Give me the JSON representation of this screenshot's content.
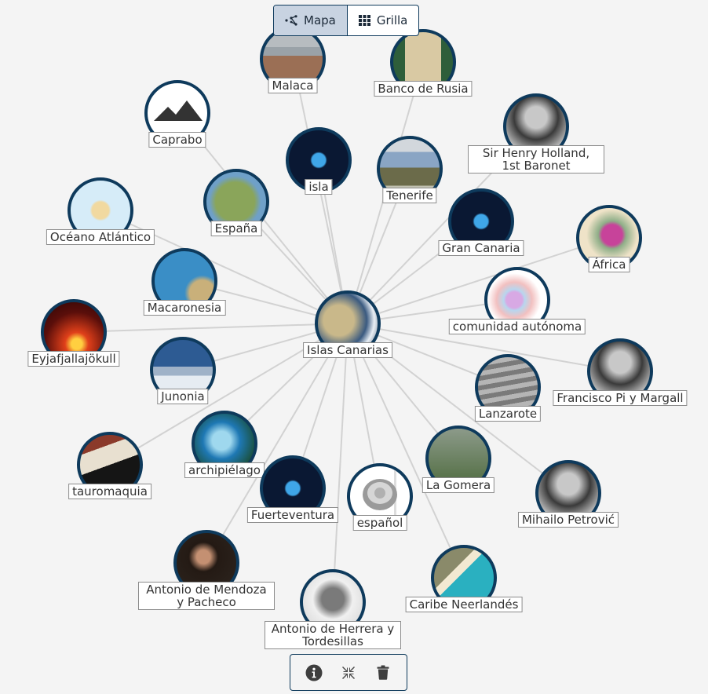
{
  "view_toggle": {
    "options": [
      {
        "label": "Mapa",
        "icon": "graph-nodes-icon",
        "active": true
      },
      {
        "label": "Grilla",
        "icon": "grid-icon",
        "active": false
      }
    ]
  },
  "graph": {
    "center": {
      "label": "Islas Canarias",
      "image": "satellite-dust-storm"
    },
    "nodes": [
      {
        "label": "Malaca",
        "image": "city-photo"
      },
      {
        "label": "Banco de Rusia",
        "image": "building-photo"
      },
      {
        "label": "Caprabo",
        "image": "placeholder-mountain-icon"
      },
      {
        "label": "isla",
        "image": "island-satellite"
      },
      {
        "label": "Sir Henry Holland, 1st Baronet",
        "image": "portrait-bw"
      },
      {
        "label": "Tenerife",
        "image": "landscape-collage"
      },
      {
        "label": "España",
        "image": "relief-map"
      },
      {
        "label": "Océano Atlántico",
        "image": "world-map"
      },
      {
        "label": "Gran Canaria",
        "image": "island-satellite"
      },
      {
        "label": "África",
        "image": "antique-map"
      },
      {
        "label": "Macaronesia",
        "image": "ocean-map"
      },
      {
        "label": "comunidad autónoma",
        "image": "regions-map"
      },
      {
        "label": "Eyjafjallajökull",
        "image": "volcano-eruption"
      },
      {
        "label": "Francisco Pi y Margall",
        "image": "portrait-bw"
      },
      {
        "label": "Junonia",
        "image": "clouds-sky"
      },
      {
        "label": "Lanzarote",
        "image": "vineyard-bw"
      },
      {
        "label": "archipiélago",
        "image": "archipelago-satellite"
      },
      {
        "label": "tauromaquia",
        "image": "bullfight-photo"
      },
      {
        "label": "Fuerteventura",
        "image": "island-satellite"
      },
      {
        "label": "La Gomera",
        "image": "forest-photo"
      },
      {
        "label": "español",
        "image": "speaker-icon"
      },
      {
        "label": "Mihailo Petrović",
        "image": "portrait-bw"
      },
      {
        "label": "Antonio de Mendoza y Pacheco",
        "image": "portrait-painting"
      },
      {
        "label": "Caribe Neerlandés",
        "image": "beach-aerial"
      },
      {
        "label": "Antonio de Herrera y Tordesillas",
        "image": "engraving-portrait"
      }
    ]
  },
  "toolbar": {
    "buttons": [
      {
        "name": "info",
        "icon": "info-icon"
      },
      {
        "name": "collapse",
        "icon": "compress-icon"
      },
      {
        "name": "delete",
        "icon": "trash-icon"
      }
    ]
  },
  "colors": {
    "node_border": "#0e3a5c",
    "edge": "#d2d2d2",
    "background": "#f4f4f4",
    "toggle_active": "#c8d3e1"
  }
}
